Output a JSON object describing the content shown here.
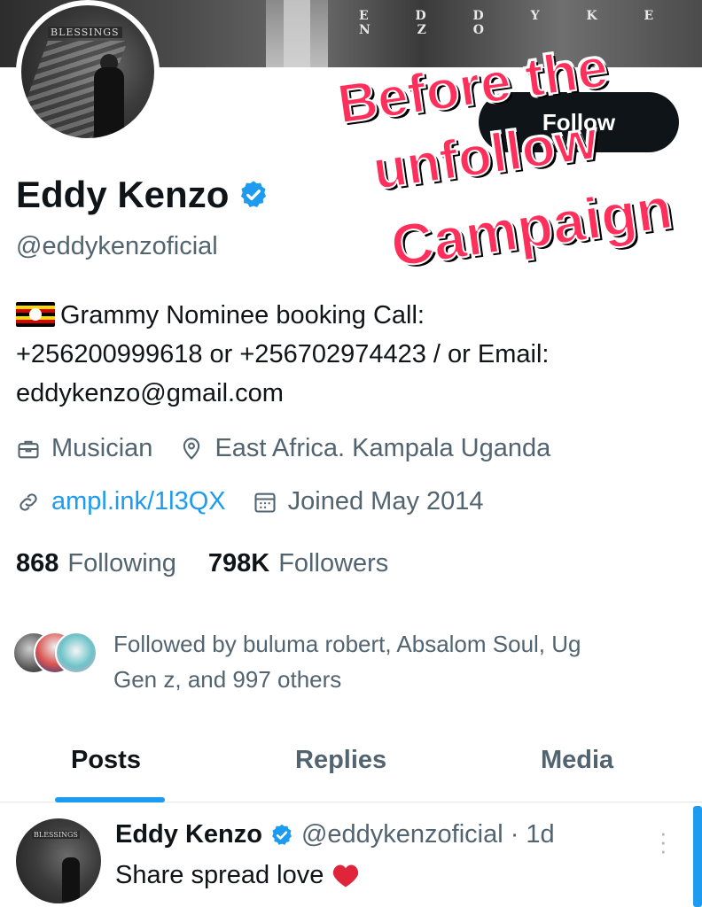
{
  "banner": {
    "text": "E D D Y  K E N Z O"
  },
  "avatar": {
    "logo_text": "BLESSINGS"
  },
  "follow_button": {
    "label": "Follow"
  },
  "overlay": {
    "line1": "Before the",
    "line2": "unfollow",
    "line3": "Campaign",
    "color": "#ff2f5b"
  },
  "profile": {
    "name": "Eddy Kenzo",
    "handle": "@eddykenzoficial",
    "bio_line1": "Grammy Nominee booking Call:",
    "bio_line2": "+256200999618 or +256702974423 / or Email:",
    "bio_line3": "eddykenzo@gmail.com",
    "profession": "Musician",
    "location": "East Africa. Kampala Uganda",
    "website": "ampl.ink/1l3QX",
    "joined": "Joined May 2014",
    "following_count": "868",
    "following_label": "Following",
    "followers_count": "798K",
    "followers_label": "Followers",
    "followed_by_line1": "Followed by buluma robert, Absalom Soul, Ug",
    "followed_by_line2": "Gen z, and 997 others"
  },
  "tabs": [
    {
      "label": "Posts",
      "active": true
    },
    {
      "label": "Replies",
      "active": false
    },
    {
      "label": "Media",
      "active": false
    }
  ],
  "post": {
    "name": "Eddy Kenzo",
    "handle": "@eddykenzoficial",
    "separator": "·",
    "time": "1d",
    "text": "Share spread love"
  },
  "colors": {
    "accent": "#1d9bf0",
    "text": "#0f1419",
    "secondary": "#536471"
  },
  "icons": [
    "verified-badge-icon",
    "briefcase-icon",
    "location-pin-icon",
    "link-icon",
    "calendar-icon",
    "heart-icon",
    "more-options-icon",
    "uganda-flag-icon"
  ]
}
